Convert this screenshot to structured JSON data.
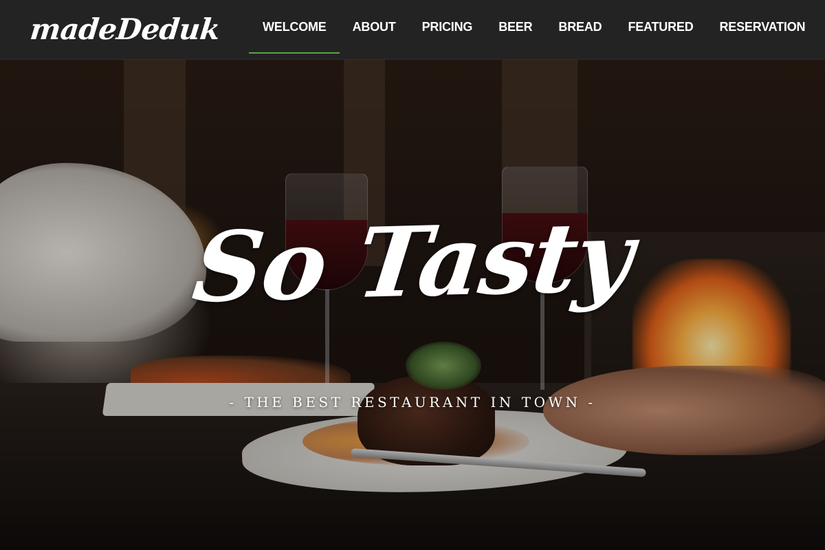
{
  "brand": {
    "logo_text": "madeDeduk"
  },
  "nav": {
    "items": [
      {
        "label": "WELCOME",
        "active": true
      },
      {
        "label": "ABOUT",
        "active": false
      },
      {
        "label": "PRICING",
        "active": false
      },
      {
        "label": "BEER",
        "active": false
      },
      {
        "label": "BREAD",
        "active": false
      },
      {
        "label": "FEATURED",
        "active": false
      },
      {
        "label": "RESERVATION",
        "active": false
      }
    ],
    "active_indicator_color": "#5aa447"
  },
  "hero": {
    "title": "So Tasty",
    "subtitle": "- THE BEST RESTAURANT IN TOWN -"
  },
  "colors": {
    "navbar_bg": "#232323",
    "text": "#ffffff"
  }
}
